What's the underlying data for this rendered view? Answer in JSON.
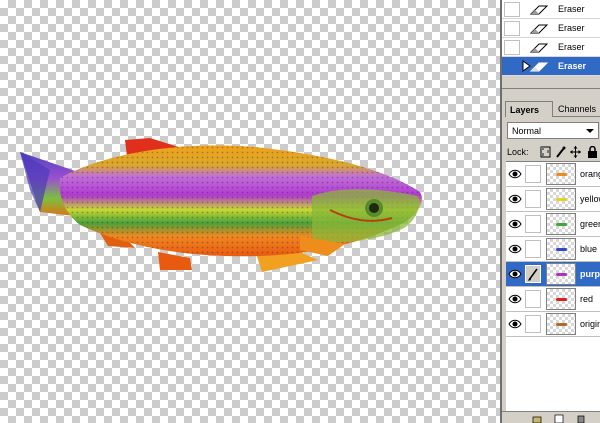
{
  "history": {
    "items": [
      {
        "label": "Eraser",
        "icon": "eraser-icon",
        "active": false
      },
      {
        "label": "Eraser",
        "icon": "eraser-icon",
        "active": false
      },
      {
        "label": "Eraser",
        "icon": "eraser-icon",
        "active": false
      },
      {
        "label": "Eraser",
        "icon": "eraser-icon",
        "active": true
      }
    ]
  },
  "layers_panel": {
    "tabs": [
      "Layers",
      "Channels"
    ],
    "blend_mode": "Normal",
    "lock_label": "Lock:",
    "layers": [
      {
        "name": "orange",
        "visible": true,
        "active": false,
        "color": "#f08a1c"
      },
      {
        "name": "yellow",
        "visible": true,
        "active": false,
        "color": "#e6d31e"
      },
      {
        "name": "green",
        "visible": true,
        "active": false,
        "color": "#3fa63a"
      },
      {
        "name": "blue",
        "visible": true,
        "active": false,
        "color": "#3048c8"
      },
      {
        "name": "purple",
        "visible": true,
        "active": true,
        "color": "#b030c0"
      },
      {
        "name": "red",
        "visible": true,
        "active": false,
        "color": "#d82020"
      },
      {
        "name": "original",
        "visible": true,
        "active": false,
        "color": "#b06a2a"
      }
    ]
  },
  "colors": {
    "selection": "#316ac5",
    "panel": "#d4d0c8"
  }
}
